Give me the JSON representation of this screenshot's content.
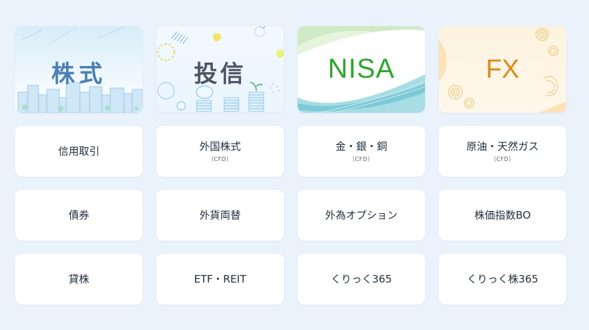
{
  "banners": [
    {
      "title": "株式"
    },
    {
      "title": "投信"
    },
    {
      "title": "NISA"
    },
    {
      "title": "FX"
    }
  ],
  "tiles": [
    {
      "label": "信用取引",
      "sub": ""
    },
    {
      "label": "外国株式",
      "sub": "（CFD）"
    },
    {
      "label": "金・銀・銅",
      "sub": "（CFD）"
    },
    {
      "label": "原油・天然ガス",
      "sub": "（CFD）"
    },
    {
      "label": "債券",
      "sub": ""
    },
    {
      "label": "外貨両替",
      "sub": ""
    },
    {
      "label": "外為オプション",
      "sub": ""
    },
    {
      "label": "株価指数BO",
      "sub": ""
    },
    {
      "label": "貸株",
      "sub": ""
    },
    {
      "label": "ETF・REIT",
      "sub": ""
    },
    {
      "label": "くりっく365",
      "sub": ""
    },
    {
      "label": "くりっく株365",
      "sub": ""
    }
  ],
  "colors": {
    "background": "#eaf2fb",
    "stock_title": "#4b7fb3",
    "nisa_title": "#2fa52e",
    "fx_title": "#d98a1e"
  }
}
